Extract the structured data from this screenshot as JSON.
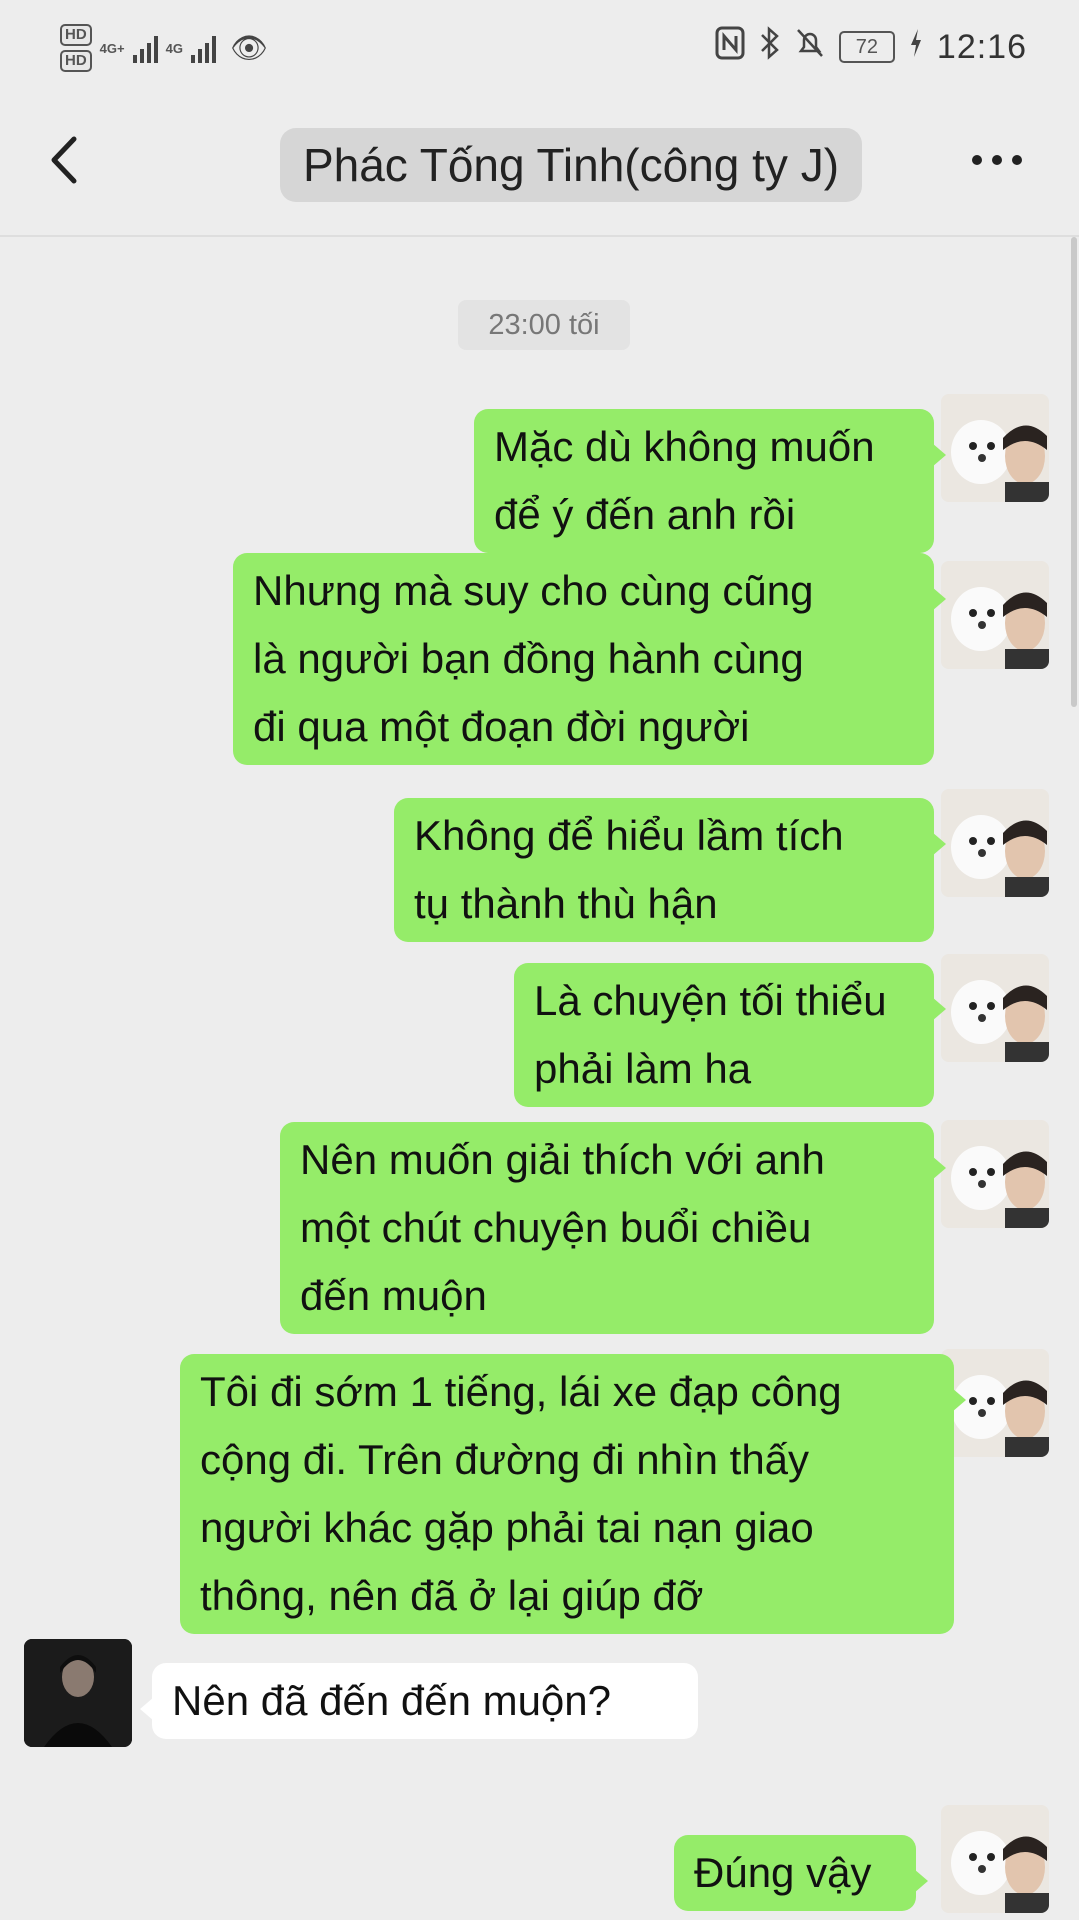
{
  "status_bar": {
    "hd1": "HD",
    "hd2": "HD",
    "net1": "4G+",
    "net2": "4G",
    "battery": "72",
    "time": "12:16",
    "icons": [
      "nfc-icon",
      "bluetooth-icon",
      "mute-icon",
      "charging-icon",
      "eye-icon"
    ]
  },
  "header": {
    "title": "Phác Tống Tinh(công ty J)"
  },
  "chat": {
    "timestamp": "23:00 tối",
    "messages": [
      {
        "sender": "me",
        "text": "Mặc dù không muốn\nđể ý đến anh rồi"
      },
      {
        "sender": "me",
        "text": "Nhưng mà suy cho cùng cũng\nlà người bạn đồng hành cùng\nđi qua một đoạn đời người"
      },
      {
        "sender": "me",
        "text": "Không để hiểu lầm tích\ntụ thành thù hận"
      },
      {
        "sender": "me",
        "text": "Là chuyện tối thiểu\nphải làm ha"
      },
      {
        "sender": "me",
        "text": "Nên muốn giải thích với anh\nmột chút chuyện buổi chiều\nđến muộn"
      },
      {
        "sender": "me",
        "text": "Tôi đi sớm 1 tiếng, lái xe đạp công\ncộng đi. Trên đường đi nhìn thấy\nngười khác gặp phải tai nạn giao\nthông, nên đã ở lại giúp đỡ"
      },
      {
        "sender": "other",
        "text": "Nên đã đến đến muộn?"
      },
      {
        "sender": "me",
        "text": "Đúng vậy"
      }
    ]
  },
  "colors": {
    "background": "#ededed",
    "my_bubble": "#95ec69",
    "their_bubble": "#ffffff"
  }
}
